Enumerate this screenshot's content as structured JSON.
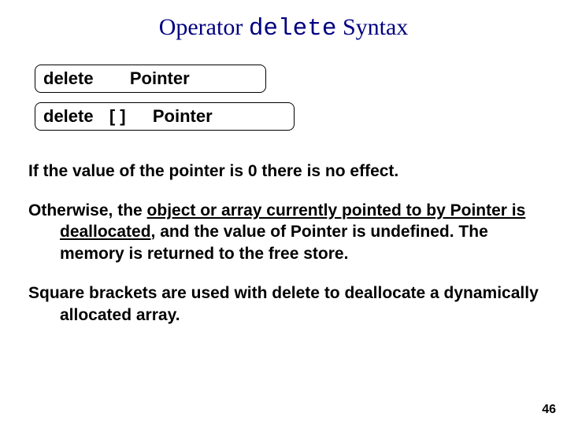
{
  "title": {
    "prefix": "Operator ",
    "code": "delete",
    "suffix": " Syntax"
  },
  "syntax": {
    "box1": {
      "kw": "delete",
      "arg": "Pointer"
    },
    "box2": {
      "kw": "delete",
      "brackets": "[ ]",
      "arg": "Pointer"
    }
  },
  "body": {
    "p1": "If the value of the pointer is 0 there is no effect.",
    "p2_lead": "Otherwise, the ",
    "p2_u": "object or array currently pointed to by Pointer is deallocated",
    "p2_tail": ", and the  value of Pointer is undefined.  The memory is returned to the free store.",
    "p3": "Square brackets are used with delete to deallocate a dynamically allocated array."
  },
  "page_number": "46"
}
